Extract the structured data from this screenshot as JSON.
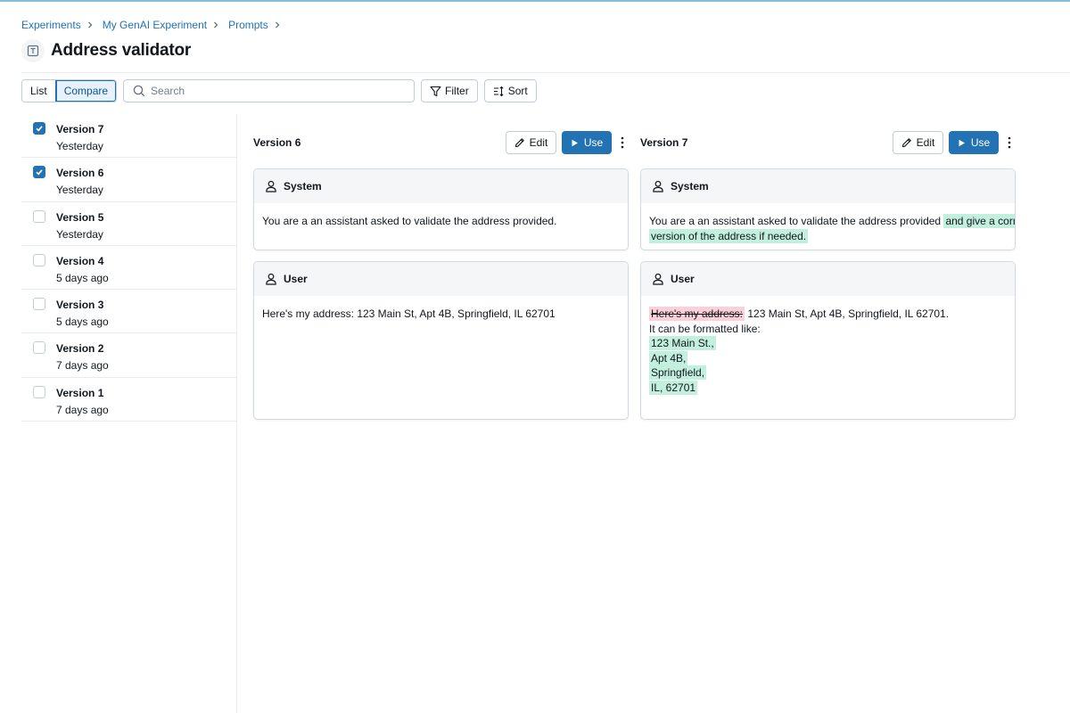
{
  "breadcrumb": [
    "Experiments",
    "My GenAI Experiment",
    "Prompts"
  ],
  "page": {
    "title": "Address validator",
    "title_icon": "text-icon"
  },
  "toolbar": {
    "view_list": "List",
    "view_compare": "Compare",
    "active_view": "Compare",
    "search_placeholder": "Search",
    "filter_label": "Filter",
    "sort_label": "Sort"
  },
  "versions": [
    {
      "name": "Version 7",
      "time": "Yesterday",
      "checked": true
    },
    {
      "name": "Version 6",
      "time": "Yesterday",
      "checked": true
    },
    {
      "name": "Version 5",
      "time": "Yesterday",
      "checked": false
    },
    {
      "name": "Version 4",
      "time": "5 days ago",
      "checked": false
    },
    {
      "name": "Version 3",
      "time": "5 days ago",
      "checked": false
    },
    {
      "name": "Version 2",
      "time": "7 days ago",
      "checked": false
    },
    {
      "name": "Version 1",
      "time": "7 days ago",
      "checked": false
    }
  ],
  "compare": {
    "edit_label": "Edit",
    "use_label": "Use",
    "left": {
      "title": "Version 6",
      "system_label": "System",
      "system_text": "You are a an assistant asked to validate the address provided.",
      "user_label": "User",
      "user_text": "Here's my address: 123 Main St, Apt 4B, Springfield, IL 62701"
    },
    "right": {
      "title": "Version 7",
      "system_label": "System",
      "system_text": "You are a an assistant asked to validate the address provided",
      "system_added_1": "and give a correct",
      "system_added_2": "version of the address if needed.",
      "user_label": "User",
      "user_deleted": "Here's my address:",
      "user_text": "123 Main St, Apt 4B, Springfield, IL 62701.",
      "user_line2": "It can be formatted like:",
      "user_added_lines": [
        "123 Main St.,",
        "Apt 4B,",
        "Springfield,",
        "IL, 62701"
      ]
    }
  },
  "colors": {
    "accent": "#2272b4",
    "added": "#c3f0de",
    "deleted": "#fbd0d8"
  }
}
